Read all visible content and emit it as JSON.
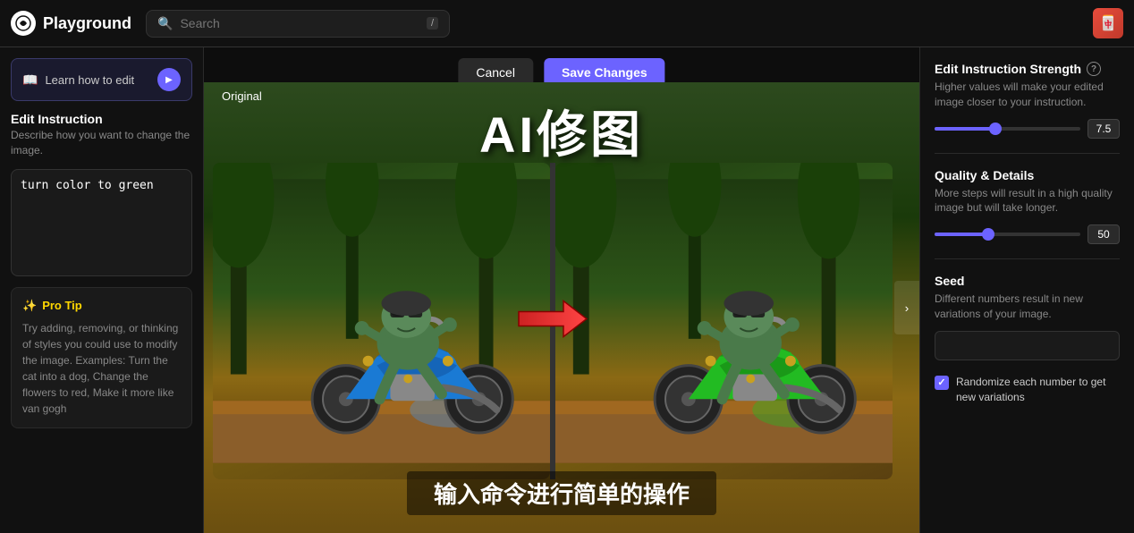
{
  "header": {
    "logo_text": "Playground",
    "search_placeholder": "Search",
    "kbd": "/",
    "avatar_emoji": "🀄"
  },
  "sidebar": {
    "learn_btn_label": "Learn how to edit",
    "section_title": "Edit Instruction",
    "section_desc": "Describe how you want to change the image.",
    "textarea_value": "turn color to green",
    "pro_tip_title": "Pro Tip",
    "pro_tip_text": "Try adding, removing, or thinking of styles you could use to modify the image. Examples: Turn the cat into a dog, Change the flowers to red, Make it more like van gogh"
  },
  "center": {
    "original_label": "Original",
    "cancel_label": "Cancel",
    "save_label": "Save Changes",
    "chinese_title": "AI修图",
    "chinese_subtitle": "输入命令进行简单的操作"
  },
  "right_sidebar": {
    "strength_title": "Edit Instruction Strength",
    "strength_desc": "Higher values will make your edited image closer to your instruction.",
    "strength_value": "7.5",
    "strength_pct": 45,
    "quality_title": "Quality & Details",
    "quality_desc": "More steps will result in a high quality image but will take longer.",
    "quality_value": "50",
    "quality_pct": 40,
    "seed_title": "Seed",
    "seed_desc": "Different numbers result in new variations of your image.",
    "seed_placeholder": "",
    "randomize_label": "Randomize each number to get new variations"
  }
}
